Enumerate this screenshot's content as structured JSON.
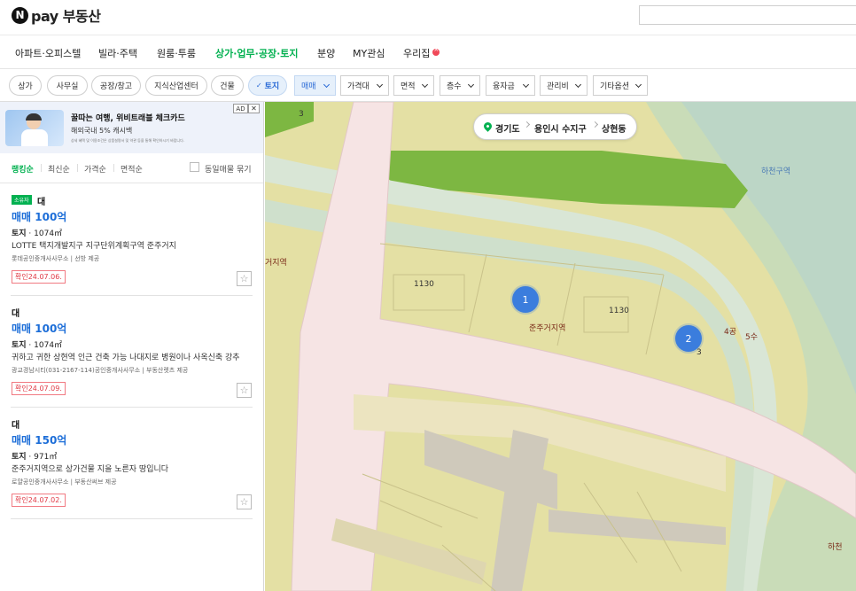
{
  "header": {
    "logo_mark": "N",
    "logo_text": "pay 부동산",
    "search_value": ""
  },
  "nav": {
    "tabs": [
      {
        "label": "아파트·오피스텔"
      },
      {
        "label": "빌라·주택"
      },
      {
        "label": "원룸·투룸"
      },
      {
        "label": "상가·업무·공장·토지",
        "active": true
      },
      {
        "label": "분양"
      },
      {
        "label": "MY관심"
      },
      {
        "label": "우리집"
      }
    ]
  },
  "filters": {
    "chips": [
      "상가",
      "사무실",
      "공장/창고",
      "지식산업센터",
      "건물",
      "토지"
    ],
    "dropdowns": [
      "매매",
      "가격대",
      "면적",
      "층수",
      "융자금",
      "관리비",
      "기타옵션"
    ]
  },
  "ad": {
    "title": "꿀따는 여행, 위비트래블 체크카드",
    "subtitle": "해외국내 5% 캐시백",
    "fine_print": "상세 혜택 및 이용조건은 상품설명서 및 약관 등을 통해 확인하시기 바랍니다.",
    "badge": "AD",
    "close": "✕"
  },
  "sort": {
    "options": [
      "랭킹순",
      "최신순",
      "가격순",
      "면적순"
    ],
    "same_listing_label": "동일매물 묶기"
  },
  "listings": [
    {
      "badge": "소유자",
      "type": "대",
      "price": "매매 100억",
      "spec_kind": "토지",
      "spec_area": " · 1074㎡",
      "desc": "LOTTE 택지개발지구 지구단위계획구역 준주거지",
      "agent": "롯데공인중개사사무소  |  선방 제공",
      "confirmed": "확인24.07.06."
    },
    {
      "badge": "",
      "type": "대",
      "price": "매매 100억",
      "spec_kind": "토지",
      "spec_area": " · 1074㎡",
      "desc": "귀하고 귀한 상현역 인근 건축 가능 나대지로 병원이나 사옥신축 강추",
      "agent": "광교경남시티(031-2167-114)공인중개사사무소  |  부동산렛츠 제공",
      "confirmed": "확인24.07.09."
    },
    {
      "badge": "",
      "type": "대",
      "price": "매매 150억",
      "spec_kind": "토지",
      "spec_area": " · 971㎡",
      "desc": "준주거지역으로 상가건물 지을 노른자 땅입니다",
      "agent": "로얄공인중개사사무소  |  부동산써브 제공",
      "confirmed": "확인24.07.02."
    }
  ],
  "map": {
    "breadcrumb": [
      "경기도",
      "용인시 수지구",
      "상현동"
    ],
    "clusters": [
      "1",
      "2"
    ],
    "labels": {
      "parcel_3_top": "3",
      "hacheon_area": "하천구역",
      "zone_left": "거지역",
      "lot_1130_a": "1130",
      "lot_1130_b": "1130",
      "junjugeo": "준주거지역",
      "gong4": "4공",
      "su5": "5수",
      "parcel_3_right": "3",
      "hacheon": "하천"
    }
  }
}
